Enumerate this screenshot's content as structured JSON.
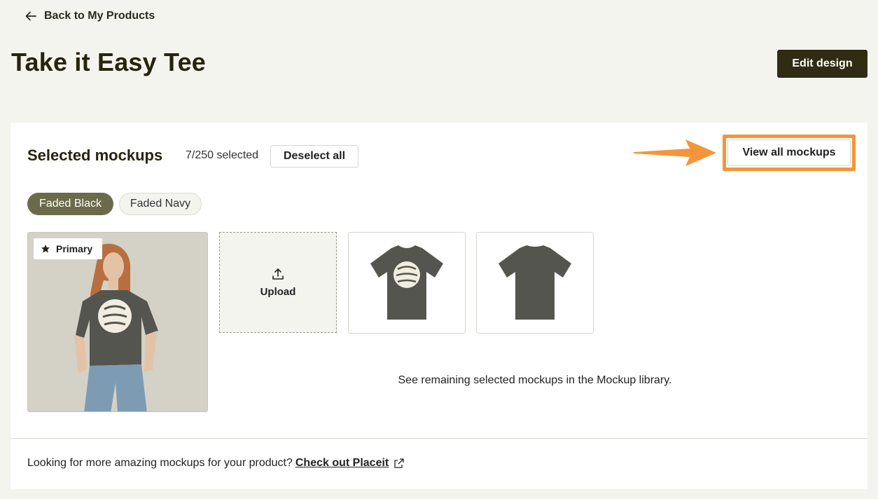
{
  "nav": {
    "back_label": "Back to My Products"
  },
  "product": {
    "title": "Take it Easy Tee",
    "edit_label": "Edit design"
  },
  "mockups": {
    "section_title": "Selected mockups",
    "selected_count": "7/250 selected",
    "deselect_label": "Deselect all",
    "view_all_label": "View all mockups",
    "colors": [
      {
        "label": "Faded Black",
        "active": true
      },
      {
        "label": "Faded Navy",
        "active": false
      }
    ],
    "primary_badge": "Primary",
    "upload_label": "Upload",
    "remaining_message": "See remaining selected mockups in the Mockup library."
  },
  "footer": {
    "prompt": "Looking for more amazing mockups for your product?",
    "link_label": "Check out Placeit"
  },
  "colors": {
    "background": "#f4f4ef",
    "dark_button": "#2f2c13",
    "active_chip": "#6b6a4a",
    "highlight": "#f5953a",
    "shirt": "#55554f"
  }
}
